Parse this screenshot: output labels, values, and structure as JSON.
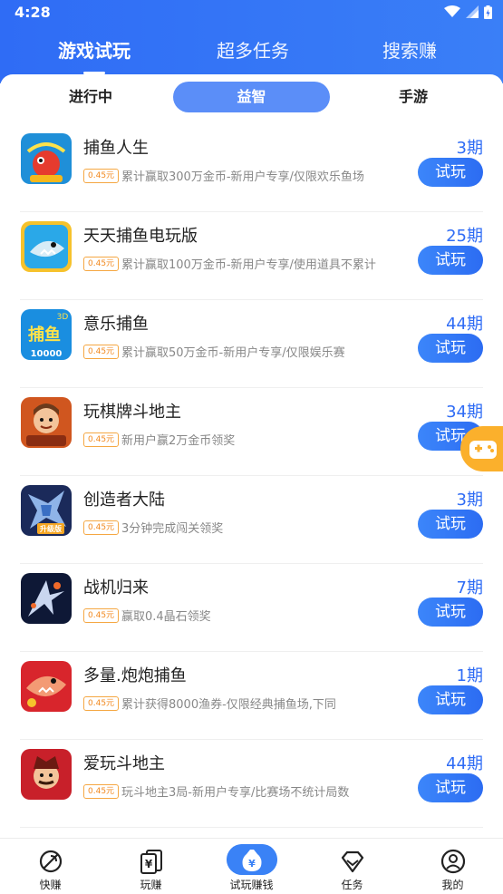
{
  "status_bar": {
    "time": "4:28"
  },
  "top_tabs": [
    {
      "label": "游戏试玩",
      "active": true
    },
    {
      "label": "超多任务",
      "active": false
    },
    {
      "label": "搜索赚",
      "active": false
    }
  ],
  "sub_tabs": [
    {
      "label": "进行中",
      "active": false
    },
    {
      "label": "益智",
      "active": true
    },
    {
      "label": "手游",
      "active": false
    }
  ],
  "games": [
    {
      "name": "捕鱼人生",
      "reward": "0.45元",
      "desc": "累计赢取300万金币-新用户专享/仅限欢乐鱼场",
      "period": "3期",
      "button": "试玩",
      "icon": "fish-game-icon"
    },
    {
      "name": "天天捕鱼电玩版",
      "reward": "0.45元",
      "desc": "累计赢取100万金币-新用户专享/使用道具不累计",
      "period": "25期",
      "button": "试玩",
      "icon": "shark-game-icon"
    },
    {
      "name": "意乐捕鱼",
      "reward": "0.45元",
      "desc": "累计赢取50万金币-新用户专享/仅限娱乐赛",
      "period": "44期",
      "button": "试玩",
      "icon": "fishing-3d-game-icon",
      "thumb_text": [
        "3D",
        "捕鱼",
        "10000"
      ]
    },
    {
      "name": "玩棋牌斗地主",
      "reward": "0.45元",
      "desc": "新用户赢2万金币领奖",
      "period": "34期",
      "button": "试玩",
      "icon": "card-game-icon"
    },
    {
      "name": "创造者大陆",
      "reward": "0.45元",
      "desc": "3分钟完成闯关领奖",
      "period": "3期",
      "button": "试玩",
      "icon": "robot-game-icon",
      "thumb_text": [
        "升级版"
      ]
    },
    {
      "name": "战机归来",
      "reward": "0.45元",
      "desc": "赢取0.4晶石领奖",
      "period": "7期",
      "button": "试玩",
      "icon": "fighter-jet-game-icon"
    },
    {
      "name": "多量.炮炮捕鱼",
      "reward": "0.45元",
      "desc": "累计获得8000渔券-仅限经典捕鱼场,下同",
      "period": "1期",
      "button": "试玩",
      "icon": "cannon-fish-game-icon"
    },
    {
      "name": "爱玩斗地主",
      "reward": "0.45元",
      "desc": "玩斗地主3局-新用户专享/比赛场不统计局数",
      "period": "44期",
      "button": "试玩",
      "icon": "landlord-card-game-icon"
    }
  ],
  "float_badge": {
    "icon": "game-controller-icon"
  },
  "bottom_nav": [
    {
      "label": "快赚",
      "icon": "rocket-icon",
      "active": false
    },
    {
      "label": "玩赚",
      "icon": "cards-icon",
      "active": false
    },
    {
      "label": "试玩赚钱",
      "icon": "money-bag-icon",
      "active": true
    },
    {
      "label": "任务",
      "icon": "diamond-icon",
      "active": false
    },
    {
      "label": "我的",
      "icon": "profile-icon",
      "active": false
    }
  ],
  "colors": {
    "primary": "#2f6cf5",
    "accent_orange": "#f28a20",
    "float_badge": "#fbb02c"
  }
}
